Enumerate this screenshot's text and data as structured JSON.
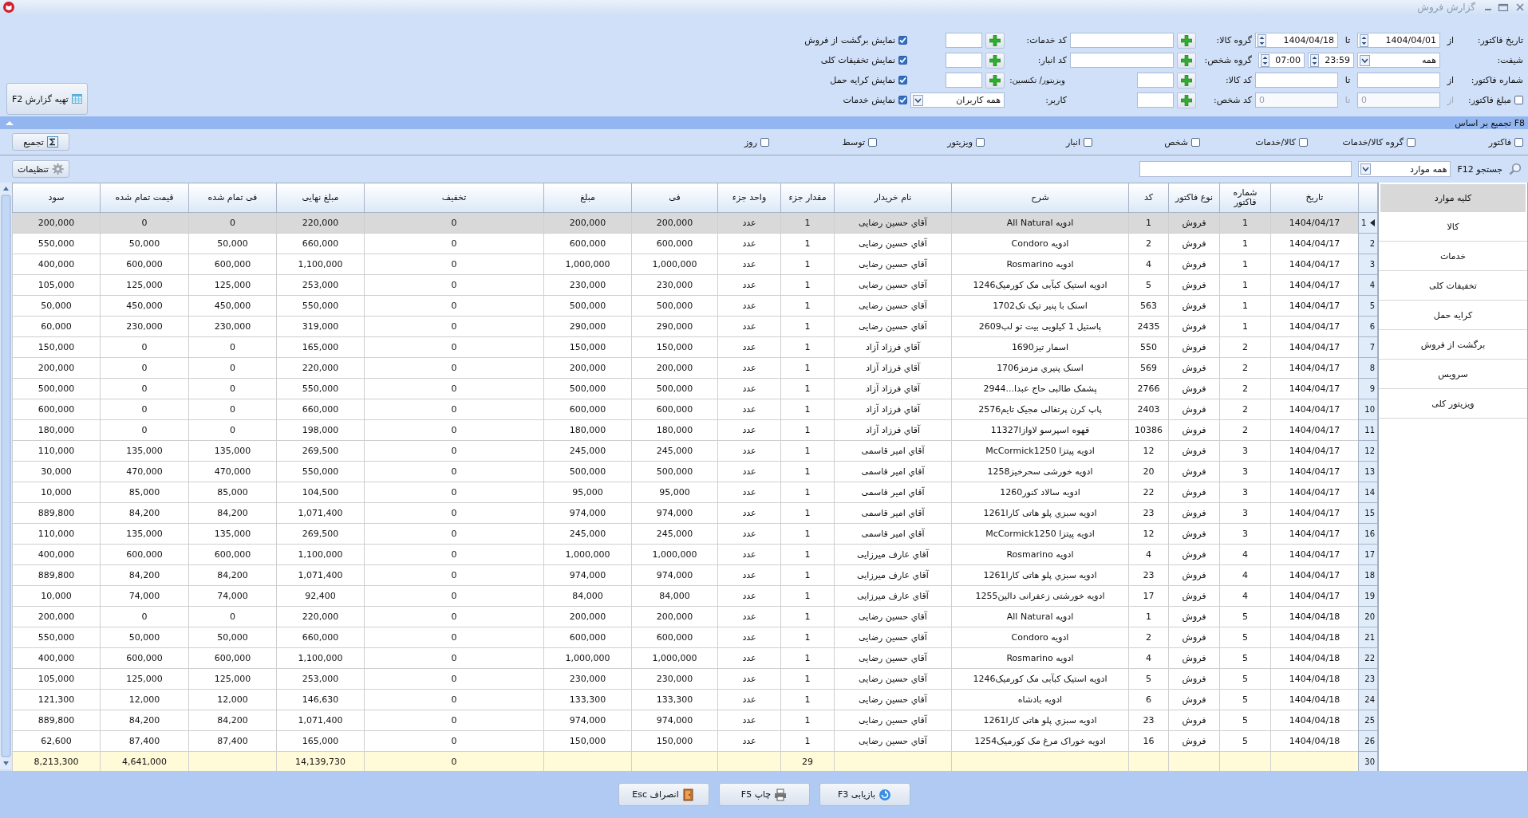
{
  "window": {
    "title": "گزارش فروش"
  },
  "filters": {
    "invoice_date": {
      "label": "تاریخ فاکتور:",
      "from_label": "از",
      "from": "1404/04/01",
      "to_label": "تا",
      "to": "1404/04/18"
    },
    "shift": {
      "label": "شیفت:",
      "value": "همه",
      "start": "07:00",
      "end": "23:59"
    },
    "invoice_number": {
      "label": "شماره فاکتور:",
      "from_label": "از",
      "to_label": "تا"
    },
    "invoice_amount": {
      "label": "مبلغ فاکتور:",
      "checked": false,
      "from_label": "از",
      "from": "0",
      "to_label": "تا",
      "to": "0"
    },
    "lookups": [
      {
        "label": "گروه کالا:"
      },
      {
        "label": "گروه شخص:"
      },
      {
        "label": "کد کالا:"
      },
      {
        "label": "کد شخص:"
      },
      {
        "label": "کد خدمات:"
      },
      {
        "label": "کد انبار:"
      },
      {
        "label": "ویزیتور/ تکنسین:"
      }
    ],
    "user": {
      "label": "کاربر:",
      "value": "همه کاربران"
    },
    "options": [
      {
        "label": "نمایش برگشت از فروش",
        "checked": true
      },
      {
        "label": "نمایش تخفیفات کلی",
        "checked": true
      },
      {
        "label": "نمایش کرایه حمل",
        "checked": true
      },
      {
        "label": "نمایش خدمات",
        "checked": true
      }
    ],
    "report_button": "تهیه گزارش F2"
  },
  "grouping": {
    "title": "F8 تجمیع بر اساس",
    "button": "تجمیع",
    "options": [
      {
        "label": "فاکتور",
        "checked": false
      },
      {
        "label": "گروه کالا/خدمات",
        "checked": false
      },
      {
        "label": "کالا/خدمات",
        "checked": false
      },
      {
        "label": "شخص",
        "checked": false
      },
      {
        "label": "انبار",
        "checked": false
      },
      {
        "label": "ویزیتور",
        "checked": false
      },
      {
        "label": "توسط",
        "checked": false
      },
      {
        "label": "روز",
        "checked": false
      }
    ]
  },
  "search": {
    "label": "جستجو F12",
    "scope": "همه موارد",
    "button": "تنظیمات"
  },
  "sidebar": {
    "items": [
      {
        "label": "کلیه موارد",
        "selected": true
      },
      {
        "label": "کالا",
        "selected": false
      },
      {
        "label": "خدمات",
        "selected": false
      },
      {
        "label": "تخفیفات کلی",
        "selected": false
      },
      {
        "label": "کرایه حمل",
        "selected": false
      },
      {
        "label": "برگشت از فروش",
        "selected": false
      },
      {
        "label": "سرویس",
        "selected": false
      },
      {
        "label": "ویزیتور کلی",
        "selected": false
      }
    ]
  },
  "table": {
    "columns": [
      "تاریخ",
      "شماره فاکتور",
      "نوع فاکتور",
      "کد",
      "شرح",
      "نام خریدار",
      "مقدار جزء",
      "واحد جزء",
      "فی",
      "مبلغ",
      "تخفیف",
      "مبلغ نهایی",
      "فی تمام شده",
      "قیمت تمام شده",
      "سود"
    ],
    "rows": [
      {
        "number": "1",
        "selected": true,
        "cells": [
          "1404/04/17",
          "1",
          "فروش",
          "1",
          "ادویه All Natural",
          "آقاي حسین  رضایی",
          "1",
          "عدد",
          "200,000",
          "200,000",
          "0",
          "220,000",
          "0",
          "0",
          "200,000"
        ]
      },
      {
        "number": "2",
        "selected": false,
        "cells": [
          "1404/04/17",
          "1",
          "فروش",
          "2",
          "ادویه Condoro",
          "آقاي حسین  رضایی",
          "1",
          "عدد",
          "600,000",
          "600,000",
          "0",
          "660,000",
          "50,000",
          "50,000",
          "550,000"
        ]
      },
      {
        "number": "3",
        "selected": false,
        "cells": [
          "1404/04/17",
          "1",
          "فروش",
          "4",
          "ادویه Rosmarino",
          "آقاي حسین  رضایی",
          "1",
          "عدد",
          "1,000,000",
          "1,000,000",
          "0",
          "1,100,000",
          "600,000",
          "600,000",
          "400,000"
        ]
      },
      {
        "number": "4",
        "selected": false,
        "cells": [
          "1404/04/17",
          "1",
          "فروش",
          "5",
          "ادویه استیک کبآبی مک کورمیک1246",
          "آقاي حسین  رضایی",
          "1",
          "عدد",
          "230,000",
          "230,000",
          "0",
          "253,000",
          "125,000",
          "125,000",
          "105,000"
        ]
      },
      {
        "number": "5",
        "selected": false,
        "cells": [
          "1404/04/17",
          "1",
          "فروش",
          "563",
          "اسنک با پنیر تیک تک1702",
          "آقاي حسین  رضایی",
          "1",
          "عدد",
          "500,000",
          "500,000",
          "0",
          "550,000",
          "450,000",
          "450,000",
          "50,000"
        ]
      },
      {
        "number": "6",
        "selected": false,
        "cells": [
          "1404/04/17",
          "1",
          "فروش",
          "2435",
          "پاستیل 1 کیلویی بیت تو لب2609",
          "آقاي حسین  رضایی",
          "1",
          "عدد",
          "290,000",
          "290,000",
          "0",
          "319,000",
          "230,000",
          "230,000",
          "60,000"
        ]
      },
      {
        "number": "7",
        "selected": false,
        "cells": [
          "1404/04/17",
          "2",
          "فروش",
          "550",
          "اسمار تیز1690",
          "آقاي فرزاد  آزاد",
          "1",
          "عدد",
          "150,000",
          "150,000",
          "0",
          "165,000",
          "0",
          "0",
          "150,000"
        ]
      },
      {
        "number": "8",
        "selected": false,
        "cells": [
          "1404/04/17",
          "2",
          "فروش",
          "569",
          "اسنک پنیري مزمز1706",
          "آقاي فرزاد  آزاد",
          "1",
          "عدد",
          "200,000",
          "200,000",
          "0",
          "220,000",
          "0",
          "0",
          "200,000"
        ]
      },
      {
        "number": "9",
        "selected": false,
        "cells": [
          "1404/04/17",
          "2",
          "فروش",
          "2766",
          "پشمک طالبی حاج عبدا...2944",
          "آقاي فرزاد  آزاد",
          "1",
          "عدد",
          "500,000",
          "500,000",
          "0",
          "550,000",
          "0",
          "0",
          "500,000"
        ]
      },
      {
        "number": "10",
        "selected": false,
        "cells": [
          "1404/04/17",
          "2",
          "فروش",
          "2403",
          "پاپ کرن پرتغالی مجیک تایم2576",
          "آقاي فرزاد  آزاد",
          "1",
          "عدد",
          "600,000",
          "600,000",
          "0",
          "660,000",
          "0",
          "0",
          "600,000"
        ]
      },
      {
        "number": "11",
        "selected": false,
        "cells": [
          "1404/04/17",
          "2",
          "فروش",
          "10386",
          "قهوه اسپرسو لاوازا11327",
          "آقاي فرزاد  آزاد",
          "1",
          "عدد",
          "180,000",
          "180,000",
          "0",
          "198,000",
          "0",
          "0",
          "180,000"
        ]
      },
      {
        "number": "12",
        "selected": false,
        "cells": [
          "1404/04/17",
          "3",
          "فروش",
          "12",
          "ادویه پیتزا McCormick1250",
          "آقاي امیر  قاسمی",
          "1",
          "عدد",
          "245,000",
          "245,000",
          "0",
          "269,500",
          "135,000",
          "135,000",
          "110,000"
        ]
      },
      {
        "number": "13",
        "selected": false,
        "cells": [
          "1404/04/17",
          "3",
          "فروش",
          "20",
          "ادویه خورشی سحرخیز1258",
          "آقاي امیر  قاسمی",
          "1",
          "عدد",
          "500,000",
          "500,000",
          "0",
          "550,000",
          "470,000",
          "470,000",
          "30,000"
        ]
      },
      {
        "number": "14",
        "selected": false,
        "cells": [
          "1404/04/17",
          "3",
          "فروش",
          "22",
          "ادویه سالاد کنور1260",
          "آقاي امیر  قاسمی",
          "1",
          "عدد",
          "95,000",
          "95,000",
          "0",
          "104,500",
          "85,000",
          "85,000",
          "10,000"
        ]
      },
      {
        "number": "15",
        "selected": false,
        "cells": [
          "1404/04/17",
          "3",
          "فروش",
          "23",
          "ادویه سبزي پلو هاتی کارا1261",
          "آقاي امیر  قاسمی",
          "1",
          "عدد",
          "974,000",
          "974,000",
          "0",
          "1,071,400",
          "84,200",
          "84,200",
          "889,800"
        ]
      },
      {
        "number": "16",
        "selected": false,
        "cells": [
          "1404/04/17",
          "3",
          "فروش",
          "12",
          "ادویه پیتزا McCormick1250",
          "آقاي امیر  قاسمی",
          "1",
          "عدد",
          "245,000",
          "245,000",
          "0",
          "269,500",
          "135,000",
          "135,000",
          "110,000"
        ]
      },
      {
        "number": "17",
        "selected": false,
        "cells": [
          "1404/04/17",
          "4",
          "فروش",
          "4",
          "ادویه Rosmarino",
          "آقاي عارف  میرزایی",
          "1",
          "عدد",
          "1,000,000",
          "1,000,000",
          "0",
          "1,100,000",
          "600,000",
          "600,000",
          "400,000"
        ]
      },
      {
        "number": "18",
        "selected": false,
        "cells": [
          "1404/04/17",
          "4",
          "فروش",
          "23",
          "ادویه سبزي پلو هاتی کارا1261",
          "آقاي عارف  میرزایی",
          "1",
          "عدد",
          "974,000",
          "974,000",
          "0",
          "1,071,400",
          "84,200",
          "84,200",
          "889,800"
        ]
      },
      {
        "number": "19",
        "selected": false,
        "cells": [
          "1404/04/17",
          "4",
          "فروش",
          "17",
          "ادویه خورشتی زعفرانی دالین1255",
          "آقاي عارف  میرزایی",
          "1",
          "عدد",
          "84,000",
          "84,000",
          "0",
          "92,400",
          "74,000",
          "74,000",
          "10,000"
        ]
      },
      {
        "number": "20",
        "selected": false,
        "cells": [
          "1404/04/18",
          "5",
          "فروش",
          "1",
          "ادویه All Natural",
          "آقاي حسین  رضایی",
          "1",
          "عدد",
          "200,000",
          "200,000",
          "0",
          "220,000",
          "0",
          "0",
          "200,000"
        ]
      },
      {
        "number": "21",
        "selected": false,
        "cells": [
          "1404/04/18",
          "5",
          "فروش",
          "2",
          "ادویه Condoro",
          "آقاي حسین  رضایی",
          "1",
          "عدد",
          "600,000",
          "600,000",
          "0",
          "660,000",
          "50,000",
          "50,000",
          "550,000"
        ]
      },
      {
        "number": "22",
        "selected": false,
        "cells": [
          "1404/04/18",
          "5",
          "فروش",
          "4",
          "ادویه Rosmarino",
          "آقاي حسین  رضایی",
          "1",
          "عدد",
          "1,000,000",
          "1,000,000",
          "0",
          "1,100,000",
          "600,000",
          "600,000",
          "400,000"
        ]
      },
      {
        "number": "23",
        "selected": false,
        "cells": [
          "1404/04/18",
          "5",
          "فروش",
          "5",
          "ادویه استیک کبآبی مک کورمیک1246",
          "آقاي حسین  رضایی",
          "1",
          "عدد",
          "230,000",
          "230,000",
          "0",
          "253,000",
          "125,000",
          "125,000",
          "105,000"
        ]
      },
      {
        "number": "24",
        "selected": false,
        "cells": [
          "1404/04/18",
          "5",
          "فروش",
          "6",
          "ادویه بادشاه",
          "آقاي حسین  رضایی",
          "1",
          "عدد",
          "133,300",
          "133,300",
          "0",
          "146,630",
          "12,000",
          "12,000",
          "121,300"
        ]
      },
      {
        "number": "25",
        "selected": false,
        "cells": [
          "1404/04/18",
          "5",
          "فروش",
          "23",
          "ادویه سبزي پلو هاتی کارا1261",
          "آقاي حسین  رضایی",
          "1",
          "عدد",
          "974,000",
          "974,000",
          "0",
          "1,071,400",
          "84,200",
          "84,200",
          "889,800"
        ]
      },
      {
        "number": "26",
        "selected": false,
        "cells": [
          "1404/04/18",
          "5",
          "فروش",
          "16",
          "ادویه خوراک مرغ مک کورمیک1254",
          "آقاي حسین  رضایی",
          "1",
          "عدد",
          "150,000",
          "150,000",
          "0",
          "165,000",
          "87,400",
          "87,400",
          "62,600"
        ]
      }
    ],
    "footer": {
      "number": "30",
      "cells": [
        null,
        null,
        null,
        null,
        null,
        null,
        "29",
        null,
        null,
        null,
        "0",
        "14,139,730",
        null,
        "4,641,000",
        "8,213,300"
      ]
    }
  },
  "actions": [
    {
      "kind": "refresh",
      "label": "بازیابی F3"
    },
    {
      "kind": "print",
      "label": "چاپ F5"
    },
    {
      "kind": "exit",
      "label": "انصراف Esc"
    }
  ]
}
